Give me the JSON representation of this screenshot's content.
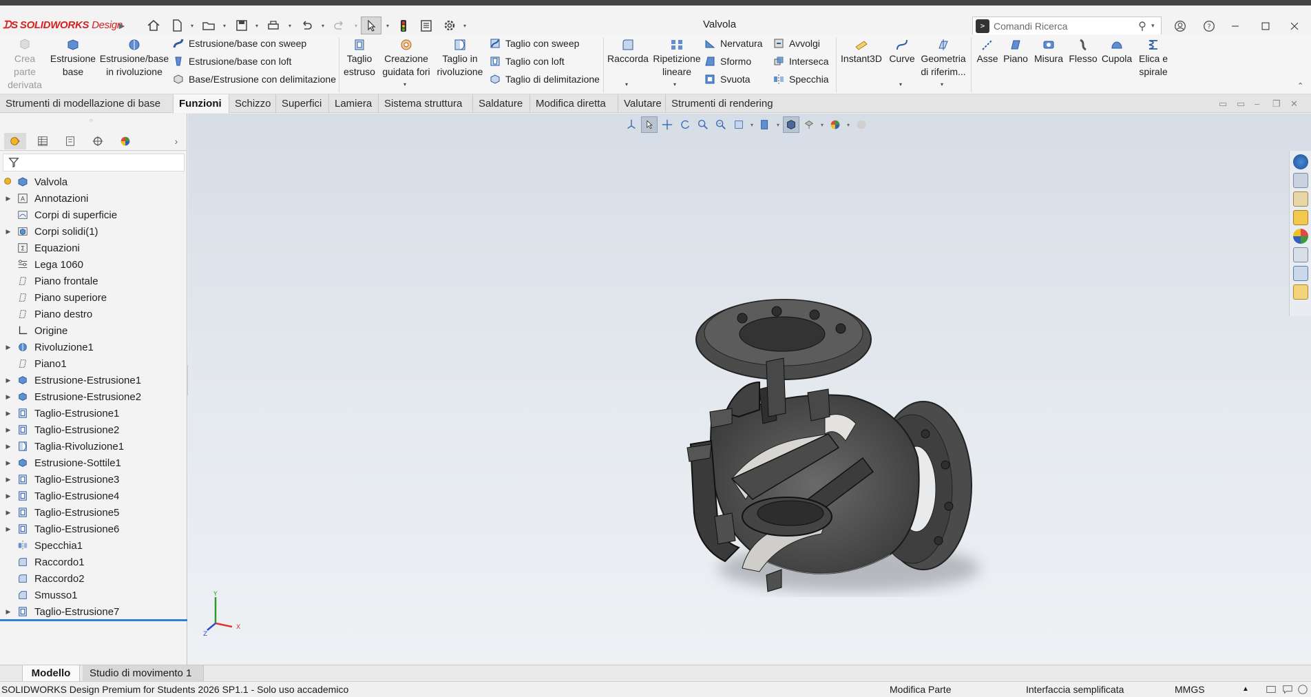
{
  "app": {
    "brand": "SOLIDWORKS",
    "brand_suffix": "Design",
    "window_title": "Valvola",
    "search_placeholder": "Comandi Ricerca"
  },
  "ribbon": {
    "crea_parte_derivata": "Crea parte derivata",
    "estrusione_base": "Estrusione base",
    "estrusione_rivoluzione": "Estrusione/base in rivoluzione",
    "estrusione_sweep": "Estrusione/base con sweep",
    "estrusione_loft": "Estrusione/base con loft",
    "base_delimitazione": "Base/Estrusione con delimitazione",
    "taglio_estruso": "Taglio estruso",
    "creazione_fori": "Creazione guidata fori",
    "taglio_rivoluzione": "Taglio in rivoluzione",
    "taglio_sweep": "Taglio con sweep",
    "taglio_loft": "Taglio con loft",
    "taglio_delimitazione": "Taglio di delimitazione",
    "raccorda": "Raccorda",
    "ripetizione_lineare": "Ripetizione lineare",
    "nervatura": "Nervatura",
    "sformo": "Sformo",
    "svuota": "Svuota",
    "avvolgi": "Avvolgi",
    "interseca": "Interseca",
    "specchia": "Specchia",
    "instant3d": "Instant3D",
    "curve": "Curve",
    "geometria_riferimento": "Geometria di riferim...",
    "asse": "Asse",
    "piano": "Piano",
    "misura": "Misura",
    "flesso": "Flesso",
    "cupola": "Cupola",
    "elica_spirale": "Elica e spirale"
  },
  "tabs": [
    "Strumenti di modellazione di base",
    "Funzioni",
    "Schizzo",
    "Superfici",
    "Lamiera",
    "Sistema struttura",
    "Saldature",
    "Modifica diretta",
    "Valutare",
    "Strumenti di rendering"
  ],
  "feature_tree": [
    {
      "label": "Valvola",
      "icon": "part-icon",
      "expandable": false
    },
    {
      "label": "Annotazioni",
      "icon": "annotations-icon",
      "expandable": true
    },
    {
      "label": "Corpi di superficie",
      "icon": "surface-bodies-icon",
      "expandable": false
    },
    {
      "label": "Corpi solidi(1)",
      "icon": "solid-bodies-icon",
      "expandable": true
    },
    {
      "label": "Equazioni",
      "icon": "equations-icon",
      "expandable": false
    },
    {
      "label": "Lega 1060",
      "icon": "material-icon",
      "expandable": false
    },
    {
      "label": "Piano frontale",
      "icon": "plane-icon",
      "expandable": false
    },
    {
      "label": "Piano superiore",
      "icon": "plane-icon",
      "expandable": false
    },
    {
      "label": "Piano destro",
      "icon": "plane-icon",
      "expandable": false
    },
    {
      "label": "Origine",
      "icon": "origin-icon",
      "expandable": false
    },
    {
      "label": "Rivoluzione1",
      "icon": "revolve-icon",
      "expandable": true
    },
    {
      "label": "Piano1",
      "icon": "plane-icon",
      "expandable": false
    },
    {
      "label": "Estrusione-Estrusione1",
      "icon": "extrude-icon",
      "expandable": true
    },
    {
      "label": "Estrusione-Estrusione2",
      "icon": "extrude-icon",
      "expandable": true
    },
    {
      "label": "Taglio-Estrusione1",
      "icon": "cut-extrude-icon",
      "expandable": true
    },
    {
      "label": "Taglio-Estrusione2",
      "icon": "cut-extrude-icon",
      "expandable": true
    },
    {
      "label": "Taglia-Rivoluzione1",
      "icon": "cut-revolve-icon",
      "expandable": true
    },
    {
      "label": "Estrusione-Sottile1",
      "icon": "extrude-icon",
      "expandable": true
    },
    {
      "label": "Taglio-Estrusione3",
      "icon": "cut-extrude-icon",
      "expandable": true
    },
    {
      "label": "Taglio-Estrusione4",
      "icon": "cut-extrude-icon",
      "expandable": true
    },
    {
      "label": "Taglio-Estrusione5",
      "icon": "cut-extrude-icon",
      "expandable": true
    },
    {
      "label": "Taglio-Estrusione6",
      "icon": "cut-extrude-icon",
      "expandable": true
    },
    {
      "label": "Specchia1",
      "icon": "mirror-icon",
      "expandable": false
    },
    {
      "label": "Raccordo1",
      "icon": "fillet-icon",
      "expandable": false
    },
    {
      "label": "Raccordo2",
      "icon": "fillet-icon",
      "expandable": false
    },
    {
      "label": "Smusso1",
      "icon": "chamfer-icon",
      "expandable": false
    },
    {
      "label": "Taglio-Estrusione7",
      "icon": "cut-extrude-icon",
      "expandable": true
    }
  ],
  "bottom_tabs": [
    "Modello",
    "Studio di movimento 1"
  ],
  "status": {
    "product": "SOLIDWORKS Design Premium for Students 2026 SP1.1 - Solo uso accademico",
    "mode": "Modifica Parte",
    "interface": "Interfaccia semplificata",
    "units": "MMGS"
  },
  "triad": {
    "x": "X",
    "y": "Y",
    "z": "Z"
  },
  "colors": {
    "brand_red": "#d62020",
    "accent_blue": "#2f7ed8",
    "model_gray": "#4a4a4a"
  }
}
